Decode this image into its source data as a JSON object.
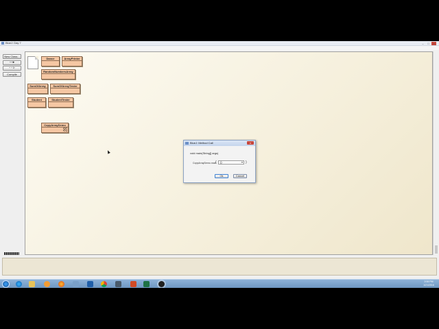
{
  "window": {
    "title": "BlueJ: Day 7",
    "controls": {
      "minimize": "–",
      "maximize": "□",
      "close": "x"
    }
  },
  "menubar": [
    "Project",
    "Edit",
    "Tools",
    "View",
    "Help"
  ],
  "toolpanel": {
    "new_class": "New Class...",
    "arrow_solid": "---▸",
    "arrow_dashed": "- - ▹",
    "compile": "Compile"
  },
  "classes": [
    {
      "id": "dance",
      "name": "Dance"
    },
    {
      "id": "arraysprinter",
      "name": "ArrayPrinter"
    },
    {
      "id": "randomnumbersarray",
      "name": "RandomNumbersArray"
    },
    {
      "id": "sumofarray",
      "name": "SumOfArray"
    },
    {
      "id": "sumofarraytester",
      "name": "SumOfArrayTester"
    },
    {
      "id": "student",
      "name": "Student"
    },
    {
      "id": "studenttester",
      "name": "StudentTester"
    },
    {
      "id": "copyarraydemo",
      "name": "CopyArrayDemo"
    }
  ],
  "dialog": {
    "title": "BlueJ: Method Call",
    "close": "x",
    "signature": "void main(String[] args)",
    "param_label": "CopyArrayDemo.main",
    "brace_open": "(",
    "brace_close": ")",
    "input_value": "{}",
    "dropdown_caret": "▾",
    "ok": "Ok",
    "cancel": "Cancel"
  },
  "taskbar": {
    "clock_time": "2:06 PM",
    "clock_date": "1/21/2016"
  },
  "colors": {
    "class_fill": "#f5c7a3",
    "canvas_bg": "#f5efdb",
    "taskbar": "#7fa5cf"
  }
}
